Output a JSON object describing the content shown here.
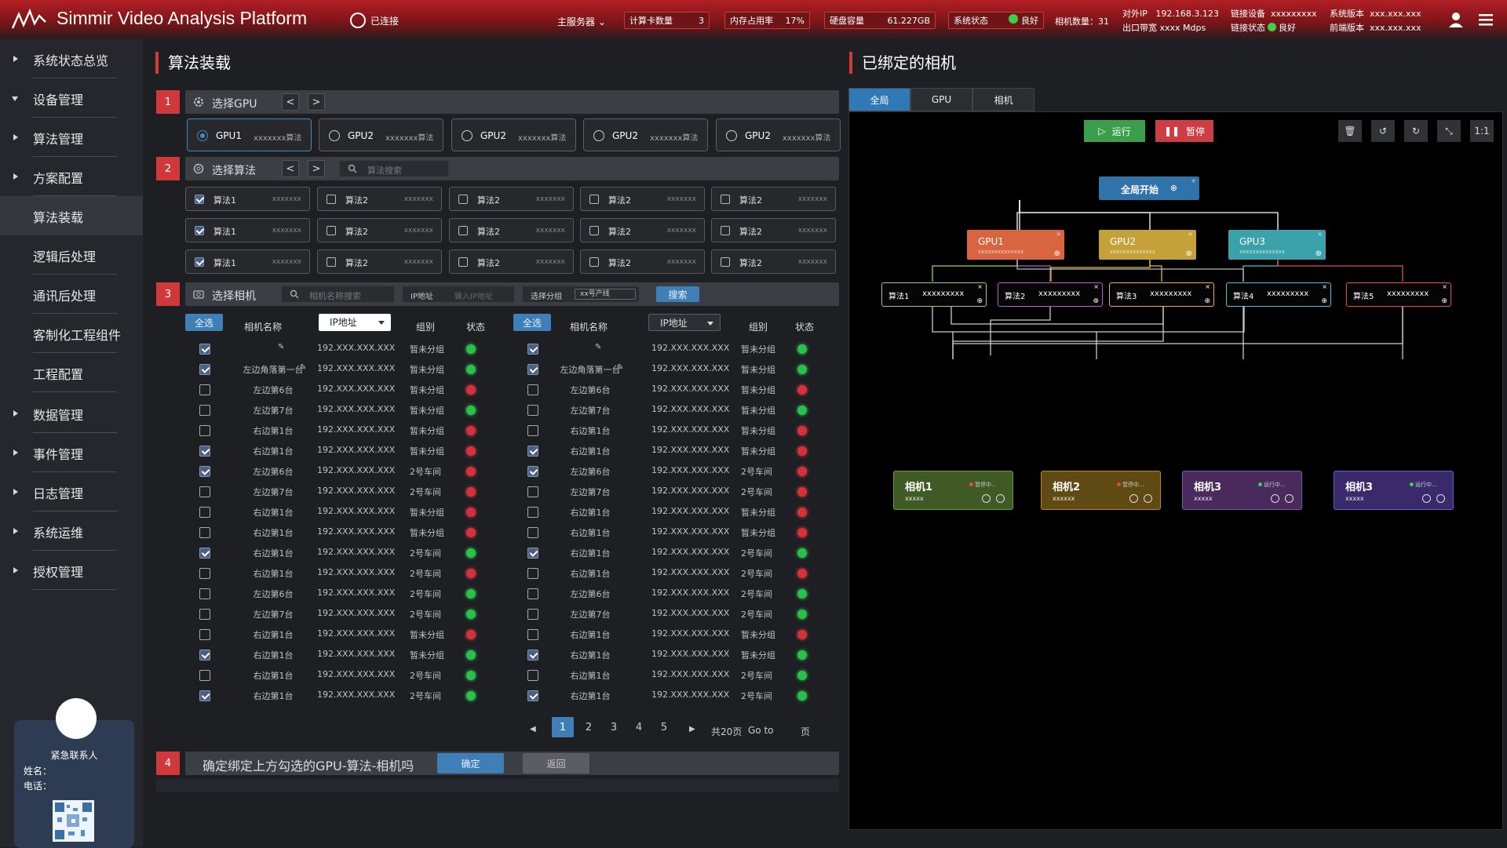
{
  "header": {
    "title": "Simmir Video Analysis Platform",
    "connection": "已连接",
    "main_server": "主服务器 ⌄",
    "compute_label": "计算卡数量",
    "compute_value": "3",
    "mem_label": "内存占用率",
    "mem_value": "17%",
    "disk_label": "硬盘容量",
    "disk_value": "61.227GB",
    "sys_label": "系统状态",
    "sys_value": "良好",
    "cam_count": "相机数量：31",
    "ext_ip_label": "对外IP",
    "ext_ip": "192.168.3.123",
    "bw_label": "出口带宽",
    "bw": "xxxx Mdps",
    "link_dev_label": "链接设备",
    "link_dev": "xxxxxxxxx",
    "link_state_label": "链接状态",
    "link_state": "良好",
    "sys_ver_label": "系统版本",
    "sys_ver": "xxx.xxx.xxx",
    "fe_ver_label": "前端版本",
    "fe_ver": "xxx.xxx.xxx"
  },
  "sidebar": {
    "items": [
      "系统状态总览",
      "设备管理",
      "算法管理",
      "方案配置",
      "算法装载",
      "逻辑后处理",
      "通讯后处理",
      "客制化工程组件",
      "工程配置",
      "数据管理",
      "事件管理",
      "日志管理",
      "系统运维",
      "授权管理"
    ],
    "contact": {
      "title": "紧急联系人",
      "name_label": "姓名：",
      "phone_label": "电话："
    }
  },
  "left_panel": {
    "title": "算法装载",
    "step1": {
      "num": "1",
      "label": "选择GPU"
    },
    "gpus": [
      {
        "name": "GPU1",
        "desc": "xxxxxxx算法",
        "selected": true
      },
      {
        "name": "GPU2",
        "desc": "xxxxxxx算法"
      },
      {
        "name": "GPU2",
        "desc": "xxxxxxx算法"
      },
      {
        "name": "GPU2",
        "desc": "xxxxxxx算法"
      },
      {
        "name": "GPU2",
        "desc": "xxxxxxx算法"
      }
    ],
    "step2": {
      "num": "2",
      "label": "选择算法",
      "search_placeholder": "算法搜索"
    },
    "algs": [
      [
        {
          "name": "算法1",
          "desc": "xxxxxxx",
          "checked": true
        },
        {
          "name": "算法2",
          "desc": "xxxxxxx"
        },
        {
          "name": "算法2",
          "desc": "xxxxxxx"
        },
        {
          "name": "算法2",
          "desc": "xxxxxxx"
        },
        {
          "name": "算法2",
          "desc": "xxxxxxx"
        }
      ],
      [
        {
          "name": "算法1",
          "desc": "xxxxxxx",
          "checked": true
        },
        {
          "name": "算法2",
          "desc": "xxxxxxx"
        },
        {
          "name": "算法2",
          "desc": "xxxxxxx"
        },
        {
          "name": "算法2",
          "desc": "xxxxxxx"
        },
        {
          "name": "算法2",
          "desc": "xxxxxxx"
        }
      ],
      [
        {
          "name": "算法1",
          "desc": "xxxxxxx",
          "checked": true
        },
        {
          "name": "算法2",
          "desc": "xxxxxxx"
        },
        {
          "name": "算法2",
          "desc": "xxxxxxx"
        },
        {
          "name": "算法2",
          "desc": "xxxxxxx"
        },
        {
          "name": "算法2",
          "desc": "xxxxxxx"
        }
      ]
    ],
    "step3": {
      "num": "3",
      "label": "选择相机",
      "cam_search_placeholder": "相机名称搜索",
      "ip_label": "IP地址",
      "ip_placeholder": "输入IP地址",
      "group_label": "选择分组",
      "group_value": "xx号产线",
      "search_btn": "搜索"
    },
    "table": {
      "select_all": "全选",
      "col_name": "相机名称",
      "col_ip": "IP地址",
      "col_group": "组别",
      "col_status": "状态",
      "rows": [
        {
          "name": "",
          "ip": "192.XXX.XXX.XXX",
          "group": "暂未分组",
          "status": "g",
          "checked": true,
          "edit": true
        },
        {
          "name": "左边角落第一台",
          "ip": "192.XXX.XXX.XXX",
          "group": "暂未分组",
          "status": "g",
          "checked": true,
          "edit": true
        },
        {
          "name": "左边第6台",
          "ip": "192.XXX.XXX.XXX",
          "group": "暂未分组",
          "status": "r",
          "checked": false
        },
        {
          "name": "左边第7台",
          "ip": "192.XXX.XXX.XXX",
          "group": "暂未分组",
          "status": "g",
          "checked": false
        },
        {
          "name": "右边第1台",
          "ip": "192.XXX.XXX.XXX",
          "group": "暂未分组",
          "status": "r",
          "checked": false
        },
        {
          "name": "右边第1台",
          "ip": "192.XXX.XXX.XXX",
          "group": "暂未分组",
          "status": "r",
          "checked": true
        },
        {
          "name": "左边第6台",
          "ip": "192.XXX.XXX.XXX",
          "group": "2号车间",
          "status": "r",
          "checked": true
        },
        {
          "name": "左边第7台",
          "ip": "192.XXX.XXX.XXX",
          "group": "2号车间",
          "status": "r",
          "checked": false
        },
        {
          "name": "右边第1台",
          "ip": "192.XXX.XXX.XXX",
          "group": "暂未分组",
          "status": "r",
          "checked": false
        },
        {
          "name": "右边第1台",
          "ip": "192.XXX.XXX.XXX",
          "group": "暂未分组",
          "status": "r",
          "checked": false
        },
        {
          "name": "右边第1台",
          "ip": "192.XXX.XXX.XXX",
          "group": "2号车间",
          "status": "g",
          "checked": true
        },
        {
          "name": "右边第1台",
          "ip": "192.XXX.XXX.XXX",
          "group": "2号车间",
          "status": "r",
          "checked": false
        },
        {
          "name": "左边第6台",
          "ip": "192.XXX.XXX.XXX",
          "group": "2号车间",
          "status": "g",
          "checked": false
        },
        {
          "name": "左边第7台",
          "ip": "192.XXX.XXX.XXX",
          "group": "2号车间",
          "status": "g",
          "checked": false
        },
        {
          "name": "右边第1台",
          "ip": "192.XXX.XXX.XXX",
          "group": "暂未分组",
          "status": "r",
          "checked": false
        },
        {
          "name": "右边第1台",
          "ip": "192.XXX.XXX.XXX",
          "group": "暂未分组",
          "status": "g",
          "checked": true
        },
        {
          "name": "右边第1台",
          "ip": "192.XXX.XXX.XXX",
          "group": "2号车间",
          "status": "g",
          "checked": false
        },
        {
          "name": "右边第1台",
          "ip": "192.XXX.XXX.XXX",
          "group": "2号车间",
          "status": "g",
          "checked": true
        }
      ]
    },
    "pagination": {
      "pages": [
        "1",
        "2",
        "3",
        "4",
        "5"
      ],
      "current": "1",
      "total": "共20页",
      "goto": "Go to",
      "page_unit": "页"
    },
    "step4": {
      "num": "4",
      "label": "确定绑定上方勾选的GPU-算法-相机吗",
      "confirm": "确定",
      "back": "返回"
    }
  },
  "right_panel": {
    "title": "已绑定的相机",
    "tabs": [
      "全局",
      "GPU",
      "相机"
    ],
    "active_tab": "全局",
    "run_label": "运行",
    "pause_label": "暂停",
    "ratio_label": "1:1",
    "root": "全局开始",
    "gpus": [
      {
        "name": "GPU1",
        "sub": "xxxxxxxxxxxxxx",
        "color": "#d8653f"
      },
      {
        "name": "GPU2",
        "sub": "xxxxxxxxxxxxxx",
        "color": "#c5a13a"
      },
      {
        "name": "GPU3",
        "sub": "xxxxxxxxxxxxxx",
        "color": "#3ba2ac"
      }
    ],
    "algs": [
      {
        "name": "算法1",
        "val": "xxxxxxxxx",
        "color": "#9fd34f"
      },
      {
        "name": "算法2",
        "val": "xxxxxxxxx",
        "color": "#b45cd6"
      },
      {
        "name": "算法3",
        "val": "xxxxxxxxx",
        "color": "#e2b93a"
      },
      {
        "name": "算法4",
        "val": "xxxxxxxxx",
        "color": "#3cc7d6"
      },
      {
        "name": "算法5",
        "val": "xxxxxxxxx",
        "color": "#e34b58"
      }
    ],
    "cams": [
      {
        "name": "相机1",
        "sub": "xxxxx",
        "state": "暂停中...",
        "bg": "#3f5a24",
        "border": "#6f9a3b",
        "dot": "#e14b4b"
      },
      {
        "name": "相机2",
        "sub": "xxxxxx",
        "state": "暂停中...",
        "bg": "#5f4a14",
        "border": "#b5892a",
        "dot": "#e14b4b"
      },
      {
        "name": "相机3",
        "sub": "xxxxx",
        "state": "运行中...",
        "bg": "#4a2a5c",
        "border": "#8052a5",
        "dot": "#3fcf45"
      },
      {
        "name": "相机3",
        "sub": "xxxxx",
        "state": "运行中...",
        "bg": "#3a2a6c",
        "border": "#6e5bc5",
        "dot": "#3fcf45"
      }
    ]
  }
}
